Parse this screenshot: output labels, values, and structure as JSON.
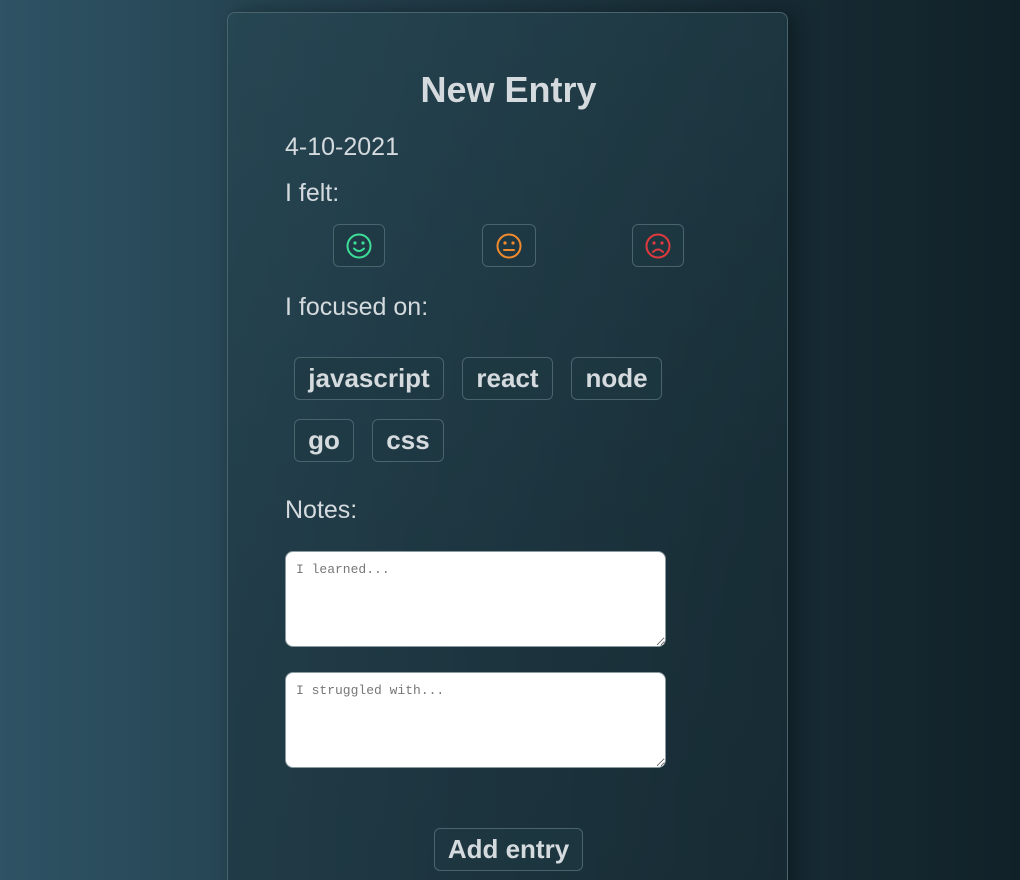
{
  "form": {
    "title": "New Entry",
    "date": "4-10-2021",
    "felt_label": "I felt:",
    "moods": [
      {
        "name": "happy",
        "icon": "smiley-face-icon",
        "color": "#3ddc97"
      },
      {
        "name": "neutral",
        "icon": "neutral-face-icon",
        "color": "#f08a2c"
      },
      {
        "name": "sad",
        "icon": "sad-face-icon",
        "color": "#e0393e"
      }
    ],
    "focus_label": "I focused on:",
    "tags": [
      "javascript",
      "react",
      "node",
      "go",
      "css"
    ],
    "notes_label": "Notes:",
    "learned_placeholder": "I learned...",
    "struggled_placeholder": "I struggled with...",
    "submit_label": "Add entry"
  }
}
